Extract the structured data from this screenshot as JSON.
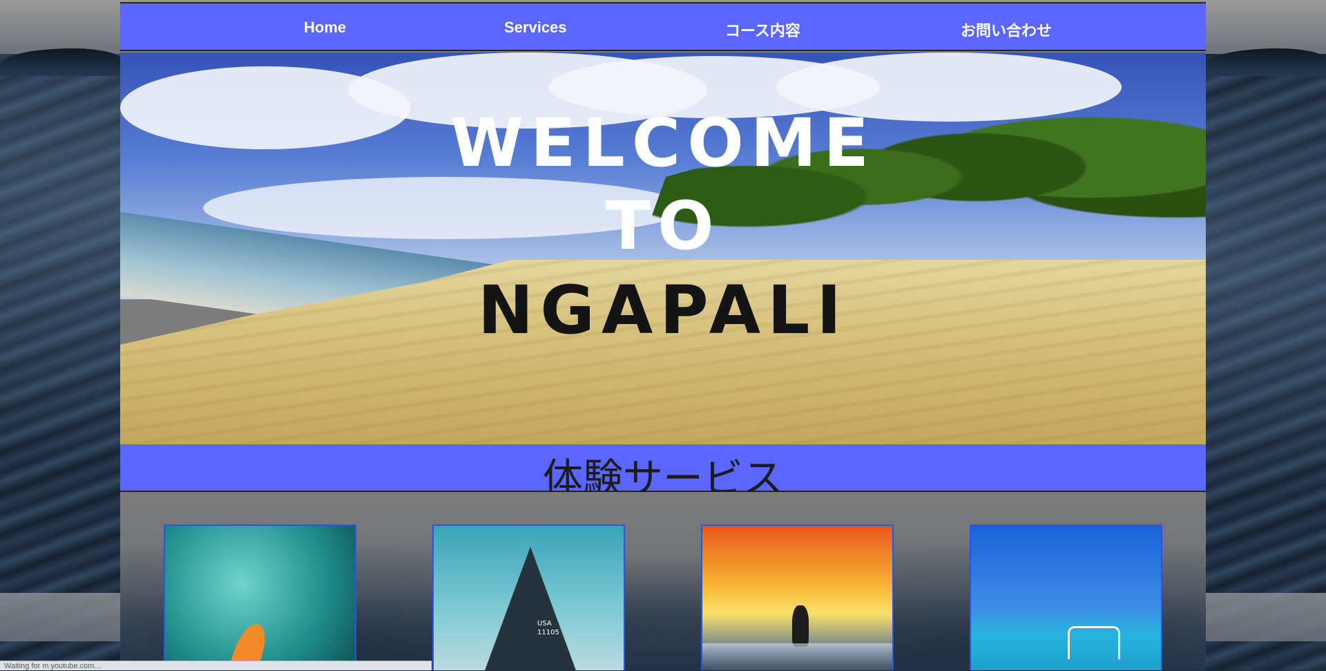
{
  "nav": {
    "items": [
      {
        "label": "Home"
      },
      {
        "label": "Services"
      },
      {
        "label": "コース内容"
      },
      {
        "label": "お問い合わせ"
      }
    ]
  },
  "hero": {
    "line1": "WELCOME",
    "line2": "TO",
    "line3": "NGAPALI"
  },
  "section": {
    "title": "体験サービス"
  },
  "cards": [
    {
      "image": "kayak-photo"
    },
    {
      "image": "sailboat-photo",
      "sail_text": "USA\n11105"
    },
    {
      "image": "surfer-photo"
    },
    {
      "image": "boat-photo"
    }
  ],
  "statusbar": {
    "text": "Waiting for m.youtube.com..."
  },
  "colors": {
    "nav_bg": "#5b66ff",
    "section_bg": "#5b66ff",
    "card_border": "#2a55e0"
  }
}
